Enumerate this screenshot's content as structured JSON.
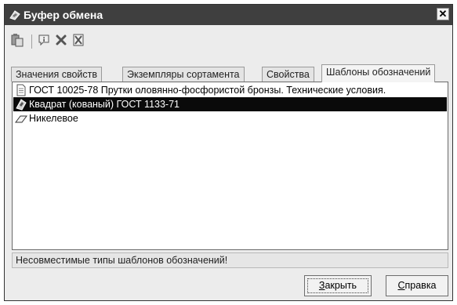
{
  "window": {
    "title": "Буфер обмена",
    "close_glyph": "✕"
  },
  "toolbar": {
    "buttons": [
      {
        "icon": "paste-icon"
      },
      {
        "icon": "info-icon"
      },
      {
        "icon": "delete-icon"
      },
      {
        "icon": "clear-all-icon"
      }
    ]
  },
  "tabs": [
    {
      "label": "Значения свойств",
      "active": false
    },
    {
      "label": "Экземпляры сортамента",
      "active": false
    },
    {
      "label": "Свойства",
      "active": false
    },
    {
      "label": "Шаблоны обозначений",
      "active": true
    }
  ],
  "list": {
    "items": [
      {
        "text": "ГОСТ 10025-78 Прутки оловянно-фосфористой бронзы. Технические условия.",
        "icon": "document-icon",
        "selected": false
      },
      {
        "text": "Квадрат (кованый) ГОСТ 1133-71",
        "icon": "profile-icon",
        "selected": true
      },
      {
        "text": "Никелевое",
        "icon": "eraser-icon",
        "selected": false
      }
    ]
  },
  "status": {
    "message": "Несовместимые типы шаблонов обозначений!"
  },
  "buttons": {
    "close_first": "З",
    "close_rest": "акрыть",
    "help_first": "С",
    "help_rest": "правка"
  }
}
